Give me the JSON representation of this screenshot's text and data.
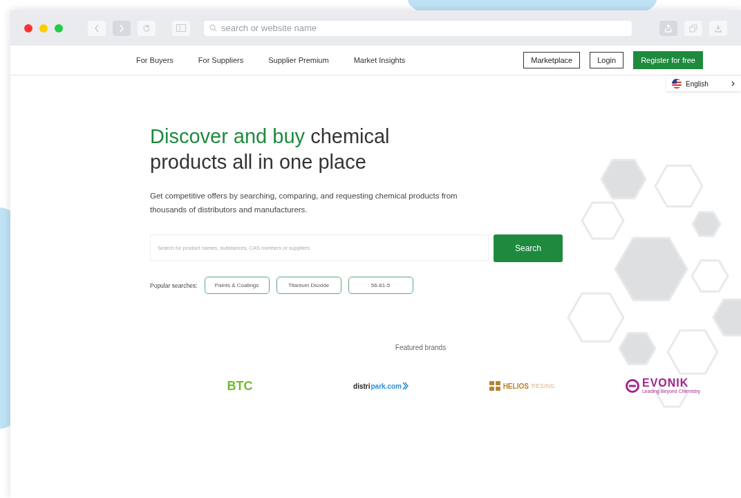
{
  "browser": {
    "address_placeholder": "search or website name"
  },
  "nav": {
    "links": [
      "For Buyers",
      "For Suppliers",
      "Supplier Premium",
      "Market Insights"
    ],
    "marketplace": "Marketplace",
    "login": "Login",
    "register": "Register for free"
  },
  "language": {
    "label": "English"
  },
  "hero": {
    "title_highlight": "Discover and buy",
    "title_rest": "chemical products all in one place",
    "subtitle": "Get competitive offers by searching, comparing, and requesting chemical products from thousands of distributors and manufacturers.",
    "search_placeholder": "Search for product names, substances, CAS numbers or suppliers",
    "search_button": "Search",
    "popular_label": "Popular searches:",
    "popular": [
      "Paints & Coatings",
      "Titanium Dioxide",
      "56-81-5"
    ]
  },
  "brands": {
    "title": "Featured brands",
    "items": [
      {
        "kind": "btc",
        "name": "BTC"
      },
      {
        "kind": "distripark",
        "name": "distri",
        "name2": "park.com"
      },
      {
        "kind": "helios",
        "name": "HELIOS",
        "name2": "RESINS"
      },
      {
        "kind": "evonik",
        "name": "EVONIK",
        "tagline": "Leading Beyond Chemistry"
      }
    ]
  }
}
